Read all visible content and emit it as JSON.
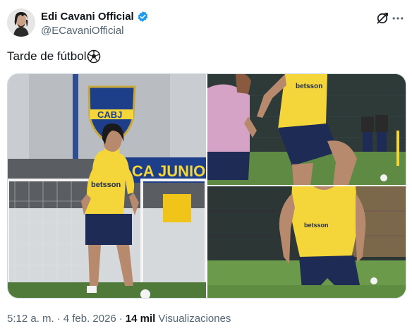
{
  "tweet": {
    "author": {
      "display_name": "Edi Cavani Official",
      "handle": "@ECavaniOfficial",
      "verified": true
    },
    "text": "Tarde de fútbol",
    "emoji": "soccer-ball",
    "media": {
      "photo_count": 3,
      "photo1": {
        "club_crest": "CABJ",
        "wall_banner": "ACA JUNIO",
        "shirt_sponsor": "betsson"
      },
      "photo2": {
        "shirt_sponsor": "betsson"
      },
      "photo3": {
        "shirt_sponsor": "betsson"
      }
    },
    "meta": {
      "time": "5:12 a. m.",
      "separator": "·",
      "date": "4 feb. 2026",
      "views_count": "14 mil",
      "views_label": "Visualizaciones"
    }
  },
  "colors": {
    "text_primary": "#0f1419",
    "text_secondary": "#536471",
    "verified_blue": "#1d9bf0",
    "border": "#cfd9de",
    "boca_yellow": "#f5d63a",
    "boca_navy": "#1d2b55"
  },
  "icons": [
    "verified-badge-icon",
    "grok-icon",
    "more-options-icon",
    "soccer-ball-icon"
  ]
}
